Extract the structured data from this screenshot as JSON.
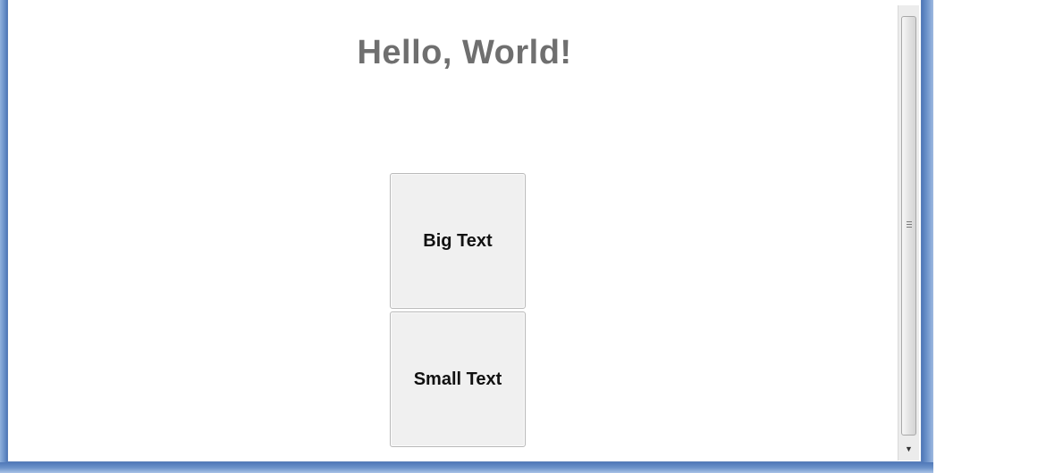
{
  "window": {
    "title_text": "Hello, World!"
  },
  "buttons": {
    "big_label": "Big Text",
    "small_label": "Small Text"
  },
  "icons": {
    "scroll_grip": "grip-icon",
    "scroll_down": "chevron-down-icon"
  },
  "colors": {
    "title": "#6f6f6f",
    "button_bg": "#f0f0f0",
    "frame_accent": "#5c86c4"
  }
}
